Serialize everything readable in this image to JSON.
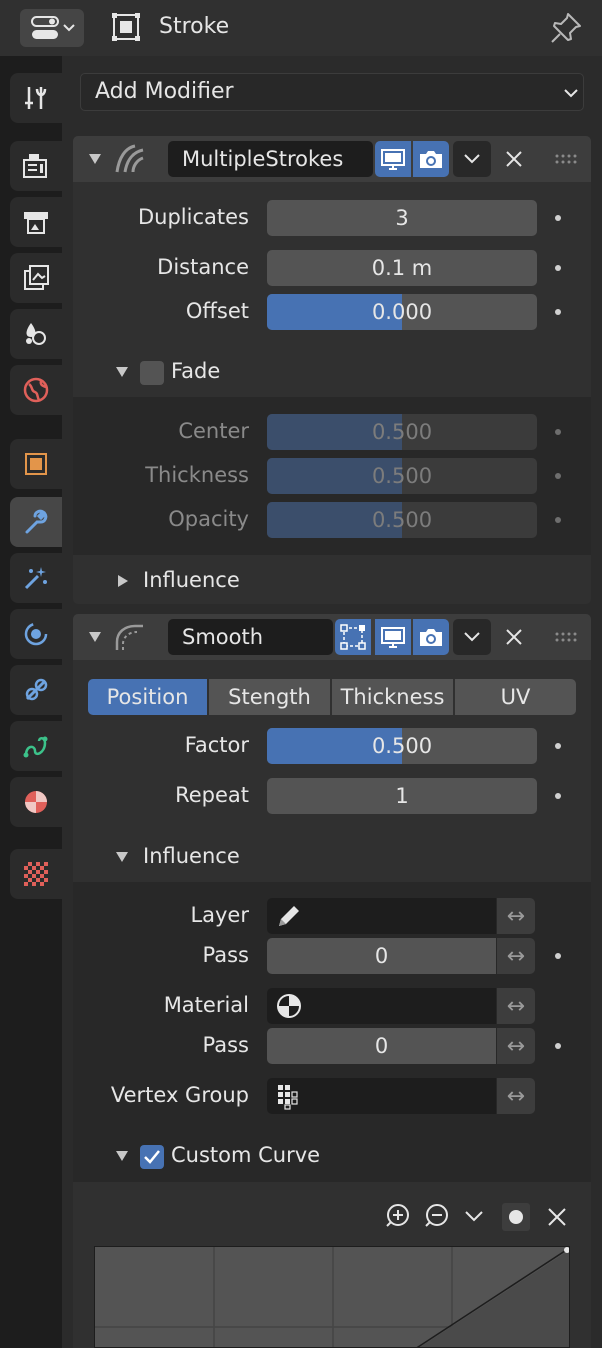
{
  "header": {
    "title": "Stroke"
  },
  "sidebar": {
    "tabs": [
      {
        "name": "tool-icon"
      },
      {
        "name": "render-icon"
      },
      {
        "name": "output-icon"
      },
      {
        "name": "view-layer-icon"
      },
      {
        "name": "scene-icon"
      },
      {
        "name": "world-icon"
      },
      {
        "name": "object-icon"
      },
      {
        "name": "modifier-icon",
        "active": true
      },
      {
        "name": "particles-icon"
      },
      {
        "name": "physics-icon"
      },
      {
        "name": "constraints-icon"
      },
      {
        "name": "data-icon"
      },
      {
        "name": "material-icon"
      },
      {
        "name": "texture-icon"
      }
    ]
  },
  "add_modifier": {
    "label": "Add Modifier"
  },
  "modifier1": {
    "name": "MultipleStrokes",
    "fields": {
      "duplicates_label": "Duplicates",
      "duplicates_value": "3",
      "distance_label": "Distance",
      "distance_value": "0.1 m",
      "offset_label": "Offset",
      "offset_value": "0.000",
      "offset_fraction": 0.5
    },
    "fade": {
      "label": "Fade",
      "checked": false,
      "center_label": "Center",
      "center_value": "0.500",
      "thickness_label": "Thickness",
      "thickness_value": "0.500",
      "opacity_label": "Opacity",
      "opacity_value": "0.500"
    },
    "influence_label": "Influence"
  },
  "modifier2": {
    "name": "Smooth",
    "tabs": [
      "Position",
      "Stength",
      "Thickness",
      "UV"
    ],
    "active_tab": "Position",
    "factor_label": "Factor",
    "factor_value": "0.500",
    "factor_fraction": 0.5,
    "repeat_label": "Repeat",
    "repeat_value": "1",
    "influence": {
      "label": "Influence",
      "layer_label": "Layer",
      "layer_pass_label": "Pass",
      "layer_pass_value": "0",
      "material_label": "Material",
      "material_pass_label": "Pass",
      "material_pass_value": "0",
      "vertex_group_label": "Vertex Group",
      "swap_glyph": "↔"
    },
    "custom_curve": {
      "label": "Custom Curve",
      "checked": true
    }
  },
  "colors": {
    "accent": "#4772b3",
    "panel": "#303030",
    "field": "#545454"
  }
}
